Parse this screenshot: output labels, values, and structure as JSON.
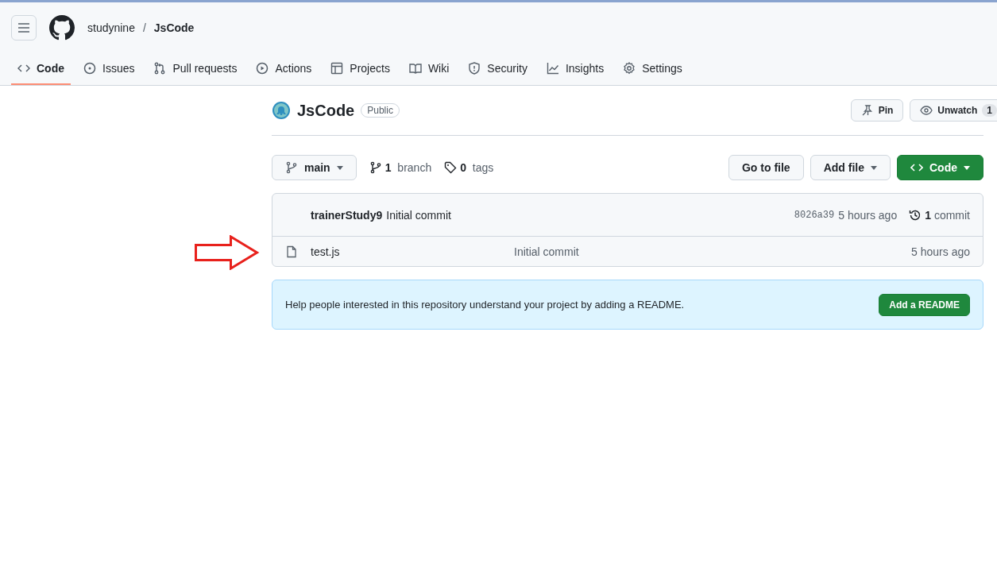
{
  "header": {
    "owner": "studynine",
    "separator": "/",
    "repo": "JsCode"
  },
  "tabs": [
    {
      "label": "Code",
      "kind": "code",
      "selected": true
    },
    {
      "label": "Issues",
      "kind": "issues",
      "selected": false
    },
    {
      "label": "Pull requests",
      "kind": "pulls",
      "selected": false
    },
    {
      "label": "Actions",
      "kind": "actions",
      "selected": false
    },
    {
      "label": "Projects",
      "kind": "projects",
      "selected": false
    },
    {
      "label": "Wiki",
      "kind": "wiki",
      "selected": false
    },
    {
      "label": "Security",
      "kind": "security",
      "selected": false
    },
    {
      "label": "Insights",
      "kind": "insights",
      "selected": false
    },
    {
      "label": "Settings",
      "kind": "settings",
      "selected": false
    }
  ],
  "repo": {
    "name": "JsCode",
    "visibility": "Public",
    "pin": "Pin",
    "unwatch": "Unwatch",
    "watchers": "1"
  },
  "branch_bar": {
    "branch": "main",
    "branch_count": "1",
    "branch_label": "branch",
    "tag_count": "0",
    "tag_label": "tags",
    "go_to_file": "Go to file",
    "add_file": "Add file",
    "code": "Code"
  },
  "commit": {
    "author": "trainerStudy9",
    "message": "Initial commit",
    "hash": "8026a39",
    "time": "5 hours ago",
    "count": "1",
    "count_label": "commit"
  },
  "files": [
    {
      "name": "test.js",
      "message": "Initial commit",
      "time": "5 hours ago"
    }
  ],
  "readme_notice": {
    "text": "Help people interested in this repository understand your project by adding a README.",
    "button": "Add a README"
  }
}
